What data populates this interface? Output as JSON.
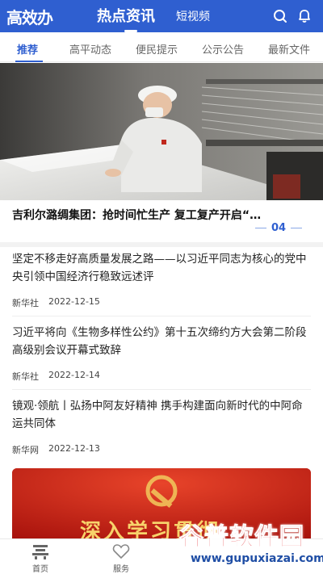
{
  "header": {
    "logo": "高效办",
    "tabs": [
      {
        "label": "热点资讯",
        "active": true
      },
      {
        "label": "短视频",
        "active": false
      }
    ],
    "accent": "#2f5fd0"
  },
  "subtabs": [
    {
      "label": "推荐",
      "active": true
    },
    {
      "label": "高平动态",
      "active": false
    },
    {
      "label": "便民提示",
      "active": false
    },
    {
      "label": "公示公告",
      "active": false
    },
    {
      "label": "最新文件",
      "active": false
    }
  ],
  "hero": {
    "title": "吉利尔潞绸集团：抢时间忙生产 复工复产开启“…",
    "page": "04"
  },
  "news": [
    {
      "title": "坚定不移走好高质量发展之路——以习近平同志为核心的党中央引领中国经济行稳致远述评",
      "source": "新华社",
      "date": "2022-12-15"
    },
    {
      "title": "习近平将向《生物多样性公约》第十五次缔约方大会第二阶段高级别会议开幕式致辞",
      "source": "新华社",
      "date": "2022-12-14"
    },
    {
      "title": "镜观·领航丨弘扬中阿友好精神 携手构建面向新时代的中阿命运共同体",
      "source": "新华网",
      "date": "2022-12-13"
    }
  ],
  "banner": {
    "text": "深入学习贯彻"
  },
  "bottom_nav": [
    {
      "label": "首页",
      "icon": "home-icon"
    },
    {
      "label": "服务",
      "icon": "heart-icon"
    }
  ],
  "watermark": {
    "text": "谷普软件园",
    "url": "www.gupuxiazai.com"
  }
}
